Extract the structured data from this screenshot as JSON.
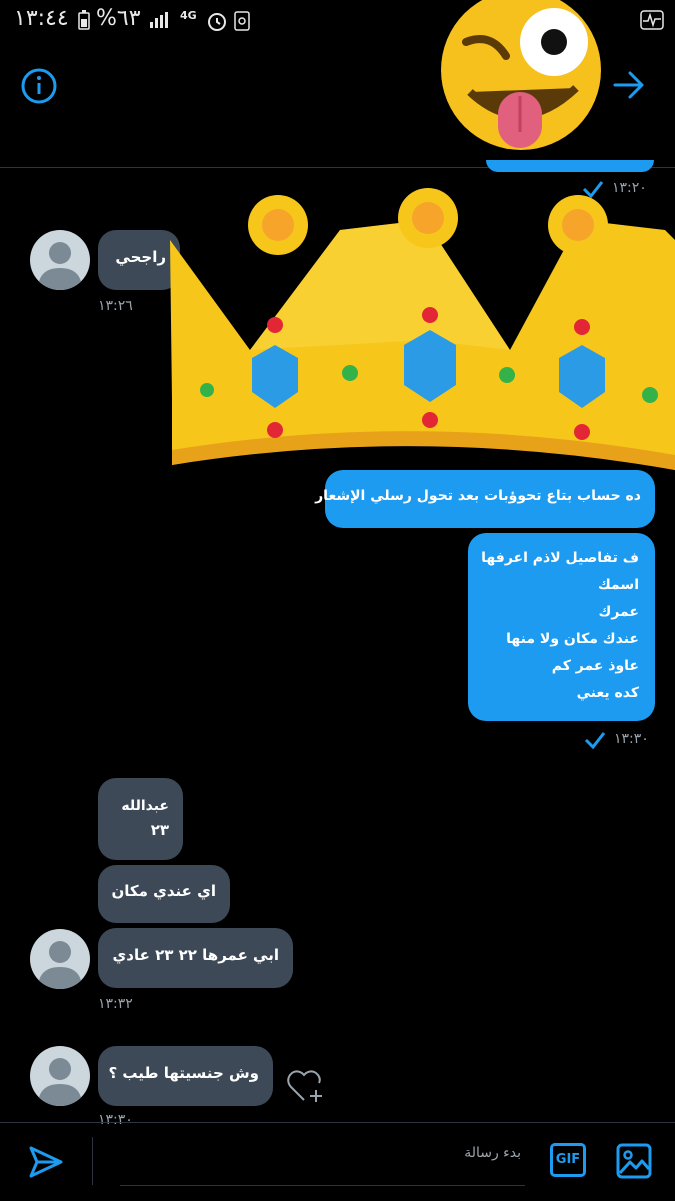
{
  "status_bar": {
    "time": "١٣:٤٤",
    "battery": "%٦٣",
    "network": "4G"
  },
  "header": {
    "info_icon": "info-icon",
    "forward_icon": "arrow-right-icon"
  },
  "messages": {
    "m0_time": "١٣:٢٠",
    "m1_text": "راجحي",
    "m1_time": "١٣:٢٦",
    "m2_text": "ده حساب بتاع تحوؤبات بعد تحول رسلي الإشعار",
    "m3_lines": [
      "ف تفاصيل لاذم اعرفها",
      "اسمك",
      "عمرك",
      "عندك مكان ولا منها",
      "عاوذ عمر كم",
      "كده يعني"
    ],
    "m3_time": "١٣:٣٠",
    "m4_lines": [
      "عبدالله",
      "٢٣"
    ],
    "m5_text": "اي عندي مكان",
    "m6_text": "ابي عمرها ٢٢ ٢٣ عادي",
    "m6_time": "١٣:٣٢",
    "m7_text": "وش جنسيتها طيب ؟",
    "m7_time": "١٣:٣٠"
  },
  "composer": {
    "placeholder": "بدء رسالة",
    "gif_label": "GIF"
  },
  "colors": {
    "accent": "#1d9bf0",
    "incoming_bubble": "#3d4957",
    "background": "#000000"
  }
}
